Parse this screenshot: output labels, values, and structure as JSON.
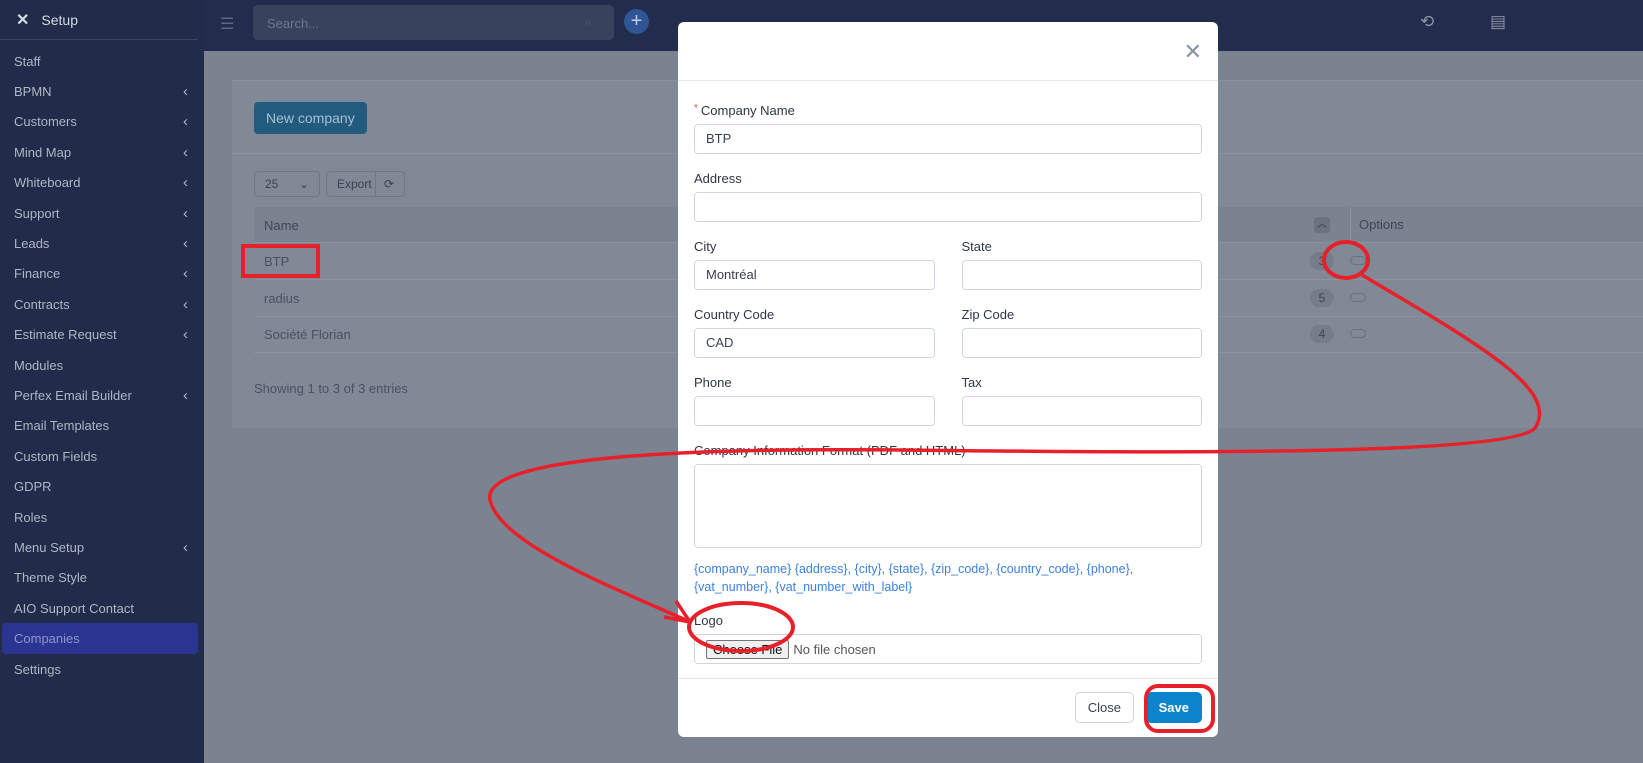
{
  "sidebar": {
    "title": "Setup",
    "close_icon": "close-icon",
    "items": [
      {
        "label": "Staff",
        "chevron": false
      },
      {
        "label": "BPMN",
        "chevron": true
      },
      {
        "label": "Customers",
        "chevron": true
      },
      {
        "label": "Mind Map",
        "chevron": true
      },
      {
        "label": "Whiteboard",
        "chevron": true
      },
      {
        "label": "Support",
        "chevron": true
      },
      {
        "label": "Leads",
        "chevron": true
      },
      {
        "label": "Finance",
        "chevron": true
      },
      {
        "label": "Contracts",
        "chevron": true
      },
      {
        "label": "Estimate Request",
        "chevron": true
      },
      {
        "label": "Modules",
        "chevron": false
      },
      {
        "label": "Perfex Email Builder",
        "chevron": true
      },
      {
        "label": "Email Templates",
        "chevron": false
      },
      {
        "label": "Custom Fields",
        "chevron": false
      },
      {
        "label": "GDPR",
        "chevron": false
      },
      {
        "label": "Roles",
        "chevron": false
      },
      {
        "label": "Menu Setup",
        "chevron": true
      },
      {
        "label": "Theme Style",
        "chevron": false
      },
      {
        "label": "AIO Support Contact",
        "chevron": false
      },
      {
        "label": "Companies",
        "chevron": false,
        "active": true
      },
      {
        "label": "Settings",
        "chevron": false
      }
    ]
  },
  "topbar": {
    "search_placeholder": "Search..."
  },
  "page": {
    "new_company": "New company",
    "page_size": "25",
    "export": "Export",
    "columns": {
      "name": "Name",
      "options": "Options"
    },
    "rows": [
      {
        "name": "BTP",
        "count": "3"
      },
      {
        "name": "radius",
        "count": "5"
      },
      {
        "name": "Société Florian",
        "count": "4"
      }
    ],
    "showing": "Showing 1 to 3 of 3 entries"
  },
  "modal": {
    "company_name_label": "Company Name",
    "company_name": "BTP",
    "address_label": "Address",
    "address": "",
    "city_label": "City",
    "city": "Montréal",
    "state_label": "State",
    "state": "",
    "country_code_label": "Country Code",
    "country_code": "CAD",
    "zip_label": "Zip Code",
    "zip": "",
    "phone_label": "Phone",
    "phone": "",
    "tax_label": "Tax",
    "tax": "",
    "format_label": "Company Information Format (PDF and HTML)",
    "tags": "{company_name} {address}, {city}, {state}, {zip_code}, {country_code}, {phone}, {vat_number}, {vat_number_with_label}",
    "logo_label": "Logo",
    "choose_file": "Choose File",
    "no_file": "No file chosen",
    "close": "Close",
    "save": "Save"
  },
  "colors": {
    "sidebar": "#212b4a",
    "active": "#2b3491",
    "save": "#0b84cc",
    "annotation": "#e8202a"
  }
}
